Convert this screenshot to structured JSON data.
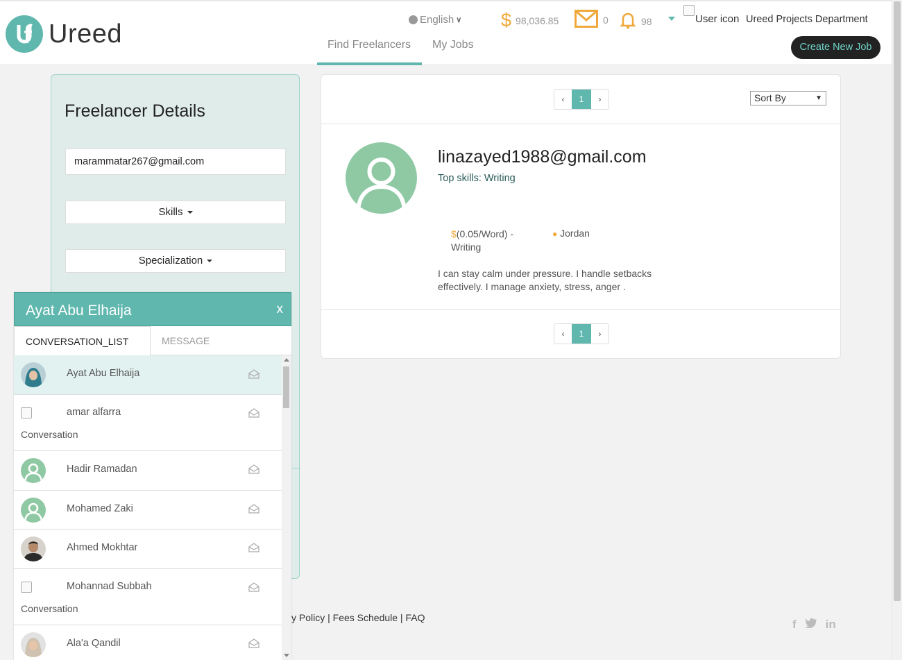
{
  "header": {
    "brand": "Ureed",
    "language": "English",
    "balance": "98,036.85",
    "messages_count": "0",
    "notifications_count": "98",
    "user_icon_alt": "User icon",
    "user_name": "Ureed Projects Department",
    "create_button": "Create New Job",
    "tabs": [
      {
        "label": "Find Freelancers",
        "active": true
      },
      {
        "label": "My Jobs",
        "active": false
      }
    ]
  },
  "filters": {
    "title": "Freelancer Details",
    "email_value": "marammatar267@gmail.com",
    "skills_label": "Skills",
    "specialization_label": "Specialization"
  },
  "results": {
    "page": "1",
    "prev": "‹",
    "next": "›",
    "sort_label": "Sort By",
    "freelancer": {
      "email": "linazayed1988@gmail.com",
      "top_skills": "Top skills: Writing",
      "currency_symbol": "$",
      "rate": "(0.05/Word) - Writing",
      "location": "Jordan",
      "bio": "I can stay calm under pressure. I handle setbacks effectively. I manage anxiety, stress, anger ."
    }
  },
  "footer": {
    "links_text": "cy Policy |  Fees Schedule |  FAQ"
  },
  "chat": {
    "title": "Ayat Abu Elhaija",
    "close": "x",
    "tab_conversations": "CONVERSATION_LIST",
    "tab_message": "MESSAGE",
    "broken_image_alt": "Conversation icon",
    "conversations": [
      {
        "name": "Ayat Abu Elhaija",
        "avatar": "photo-hijab-teal",
        "selected": true
      },
      {
        "name": "amar alfarra",
        "avatar": "broken",
        "selected": false
      },
      {
        "name": "Hadir Ramadan",
        "avatar": "default",
        "selected": false
      },
      {
        "name": "Mohamed Zaki",
        "avatar": "default",
        "selected": false
      },
      {
        "name": "Ahmed Mokhtar",
        "avatar": "photo-man",
        "selected": false
      },
      {
        "name": "Mohannad Subbah",
        "avatar": "broken",
        "selected": false
      },
      {
        "name": "Ala'a Qandil",
        "avatar": "photo-hijab-light",
        "selected": false
      }
    ]
  },
  "colors": {
    "accent": "#5fb7ad",
    "orange": "#f0a83a",
    "avatar_green": "#8fc9a4"
  }
}
